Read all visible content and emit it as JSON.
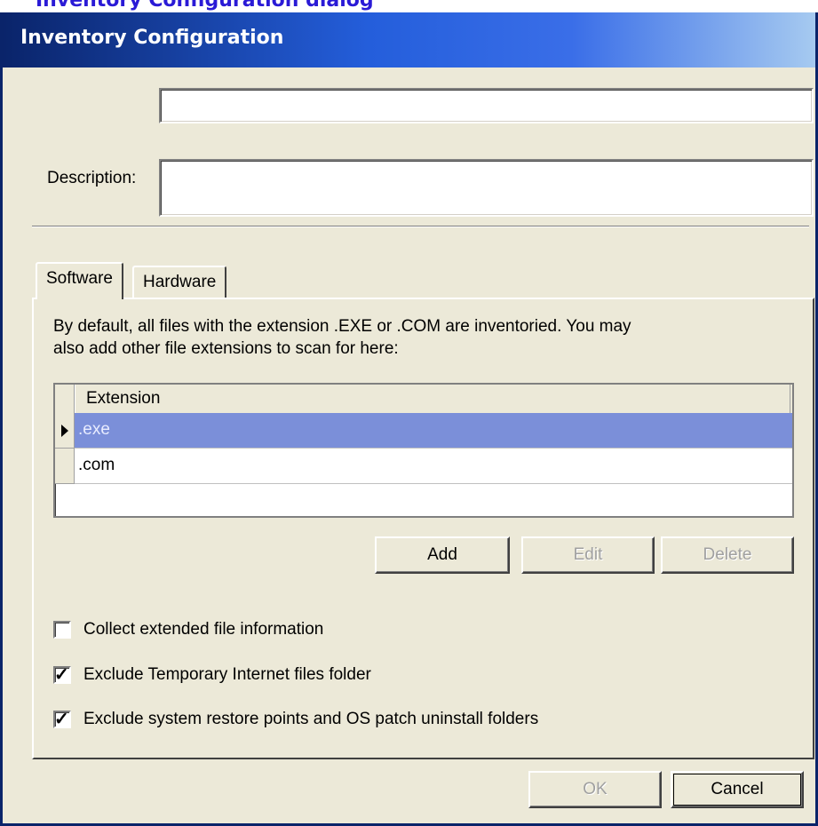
{
  "top_caption": "Inventory Configuration dialog",
  "window": {
    "title": "Inventory Configuration"
  },
  "name_field": {
    "value": ""
  },
  "description": {
    "label": "Description:",
    "value": ""
  },
  "tabs": [
    {
      "label": "Software",
      "active": true
    },
    {
      "label": "Hardware",
      "active": false
    }
  ],
  "software": {
    "intro_line1": "By default, all files with the extension .EXE or .COM are inventoried.  You may",
    "intro_line2": "also add other file extensions to scan for here:",
    "grid": {
      "column_header": "Extension",
      "rows": [
        {
          "value": ".exe",
          "selected": true
        },
        {
          "value": ".com",
          "selected": false
        }
      ]
    },
    "buttons": {
      "add": "Add",
      "edit": "Edit",
      "delete": "Delete"
    },
    "options": [
      {
        "label": "Collect extended file information",
        "checked": false
      },
      {
        "label": "Exclude Temporary Internet files folder",
        "checked": true
      },
      {
        "label": "Exclude system restore points and OS patch uninstall folders",
        "checked": true
      }
    ]
  },
  "footer": {
    "ok": "OK",
    "cancel": "Cancel"
  },
  "colors": {
    "selection": "#7b8fd9",
    "face": "#ece9d8",
    "title_start": "#0a246a",
    "title_end": "#a6caf0"
  }
}
